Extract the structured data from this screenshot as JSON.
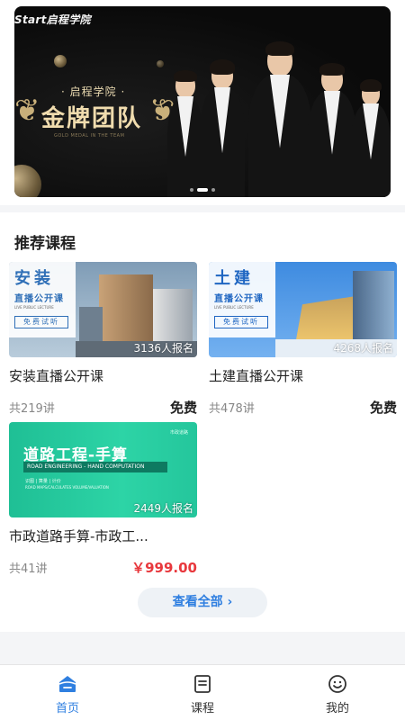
{
  "banner": {
    "logo": "Start启程学院",
    "subtitle": "· 启程学院 ·",
    "headline": "金牌团队",
    "tagline": "GOLD MEDAL IN THE TEAM",
    "slides": 3,
    "active_slide": 1
  },
  "recommended": {
    "title": "推荐课程",
    "courses": [
      {
        "thumb_title": "安装",
        "thumb_sub": "直播公开课",
        "thumb_en": "LIVE PUBLIC LECTURE",
        "thumb_badge": "免费试听",
        "enrolled": "3136人报名",
        "title": "安装直播公开课",
        "lessons": "共219讲",
        "price": "免费"
      },
      {
        "thumb_title": "土建",
        "thumb_sub": "直播公开课",
        "thumb_en": "LIVE PUBLIC LECTURE",
        "thumb_badge": "免费试听",
        "enrolled": "4268人报名",
        "title": "土建直播公开课",
        "lessons": "共478讲",
        "price": "免费"
      },
      {
        "thumb_title": "道路工程-手算",
        "thumb_sub": "ROAD ENGINEERING - HAND COMPUTATION",
        "thumb_en": "识图 | 算量 | 计价",
        "thumb_badge": "ROAD MAPS/CALCULATES VOLUME/VALUATION",
        "thumb_tag": "市政道路",
        "enrolled": "2449人报名",
        "title": "市政道路手算-市政工...",
        "lessons": "共41讲",
        "price": "￥999.00"
      }
    ],
    "view_all": "查看全部 ›"
  },
  "tabbar": {
    "items": [
      {
        "label": "首页",
        "icon": "home-icon",
        "active": true
      },
      {
        "label": "课程",
        "icon": "course-icon",
        "active": false
      },
      {
        "label": "我的",
        "icon": "profile-icon",
        "active": false
      }
    ]
  },
  "colors": {
    "accent": "#2f7fe0",
    "price_red": "#e8383d",
    "banner_gold": "#f0dcae"
  }
}
